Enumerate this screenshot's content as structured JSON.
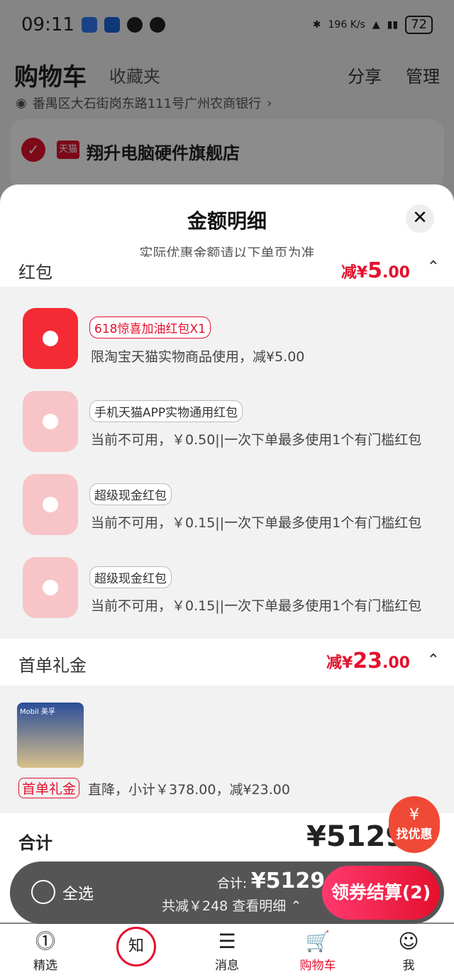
{
  "status": {
    "time": "09:11",
    "net": "196 K/s",
    "battery": "72"
  },
  "top": {
    "title": "购物车",
    "favorites": "收藏夹",
    "share": "分享",
    "manage": "管理"
  },
  "address": "番禺区大石街岗东路111号广州农商银行",
  "shop": {
    "badge": "天猫",
    "name": "翔升电脑硬件旗舰店"
  },
  "sheet": {
    "title": "金额明细",
    "subtitle": "实际优惠金额请以下单页为准",
    "close": "✕",
    "redpacket": {
      "label": "红包",
      "amount_prefix": "减¥",
      "amount_int": "5",
      "amount_dec": ".00"
    },
    "packets": [
      {
        "tag": "618惊喜加油红包X1",
        "text": "限淘宝天猫实物商品使用，减¥5.00",
        "active": true
      },
      {
        "tag": "手机天猫APP实物通用红包",
        "text": "当前不可用，￥0.50||一次下单最多使用1个有门槛红包",
        "active": false
      },
      {
        "tag": "超级现金红包",
        "text": "当前不可用，￥0.15||一次下单最多使用1个有门槛红包",
        "active": false
      },
      {
        "tag": "超级现金红包",
        "text": "当前不可用，￥0.15||一次下单最多使用1个有门槛红包",
        "active": false
      }
    ],
    "firstorder": {
      "label": "首单礼金",
      "amount_prefix": "减¥",
      "amount_int": "23",
      "amount_dec": ".00"
    },
    "product": {
      "img_label": "Mobil 美孚",
      "tag": "首单礼金",
      "text": "直降，小计￥378.00，减¥23.00"
    },
    "total": {
      "label": "合计",
      "value": "¥5129"
    }
  },
  "find": {
    "icon": "¥",
    "label": "找优惠"
  },
  "bottom": {
    "select_all": "全选",
    "total_label": "合计: ",
    "total_value": "¥5129",
    "saved": "共减￥248  查看明细 ⌃",
    "checkout": "领券结算(2)"
  },
  "tabs": [
    {
      "label": "精选",
      "icon": "⓵"
    },
    {
      "label": "",
      "icon": "知"
    },
    {
      "label": "消息",
      "icon": "☰"
    },
    {
      "label": "购物车",
      "icon": "🛒"
    },
    {
      "label": "我",
      "icon": "☺"
    }
  ],
  "colors": {
    "accent": "#e4102d",
    "sheet_bg": "#f2f2f2",
    "bar": "#555555"
  }
}
